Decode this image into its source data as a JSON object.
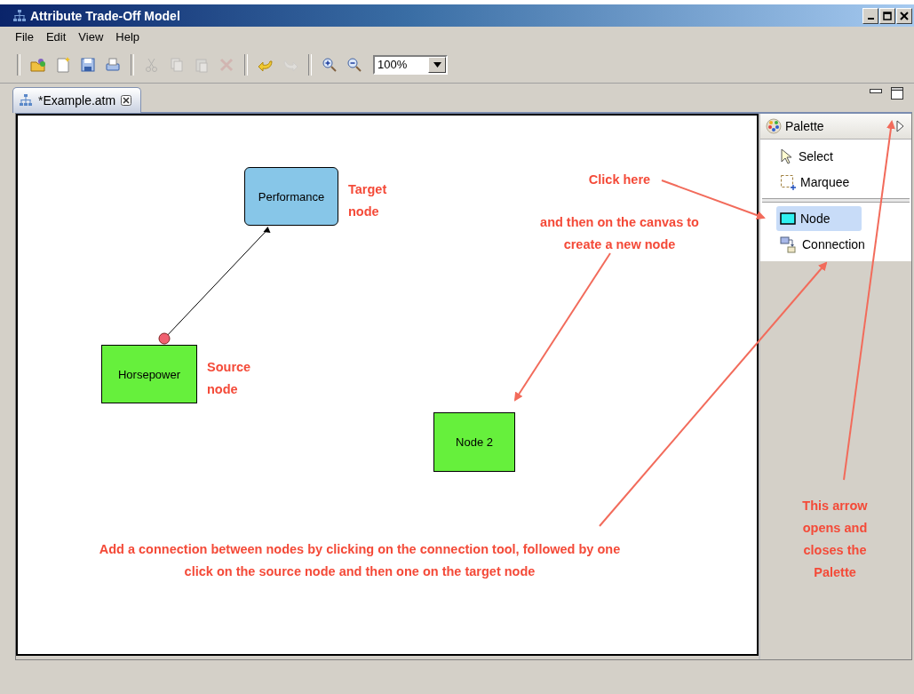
{
  "window": {
    "title": "Attribute Trade-Off Model"
  },
  "menu": [
    "File",
    "Edit",
    "View",
    "Help"
  ],
  "toolbar": [
    [
      {
        "kind": "open",
        "disabled": false
      },
      {
        "kind": "new",
        "disabled": false
      },
      {
        "kind": "save",
        "disabled": false
      },
      {
        "kind": "print",
        "disabled": false
      }
    ],
    [
      {
        "kind": "cut",
        "disabled": true
      },
      {
        "kind": "copy",
        "disabled": true
      },
      {
        "kind": "paste",
        "disabled": true
      },
      {
        "kind": "delete",
        "disabled": true
      }
    ],
    [
      {
        "kind": "undo",
        "disabled": false
      },
      {
        "kind": "redo",
        "disabled": true
      }
    ],
    [
      {
        "kind": "zoom-in",
        "disabled": false
      },
      {
        "kind": "zoom-out",
        "disabled": false
      }
    ]
  ],
  "zoom": {
    "value": "100%"
  },
  "editor_tab": {
    "label": "*Example.atm"
  },
  "nodes": [
    {
      "label": "Performance",
      "color": "#87c6e8"
    },
    {
      "label": "Horsepower",
      "color": "#66f03c"
    },
    {
      "label": "Node 2",
      "color": "#66f03c"
    }
  ],
  "palette": {
    "title": "Palette",
    "items": [
      {
        "label": "Select",
        "kind": "select",
        "selected": false
      },
      {
        "label": "Marquee",
        "kind": "marquee",
        "selected": false
      },
      {
        "label": "Node",
        "kind": "node",
        "selected": true
      },
      {
        "label": "Connection",
        "kind": "connection",
        "selected": false
      }
    ]
  },
  "annotations": [
    "Target\nnode",
    "Source\nnode",
    "Click here",
    "and then on the canvas to\ncreate a new node",
    "Add a connection between nodes by clicking on the connection tool, followed by one\nclick on the source node and then one on the target node",
    "This arrow\nopens and\ncloses the\nPalette"
  ]
}
